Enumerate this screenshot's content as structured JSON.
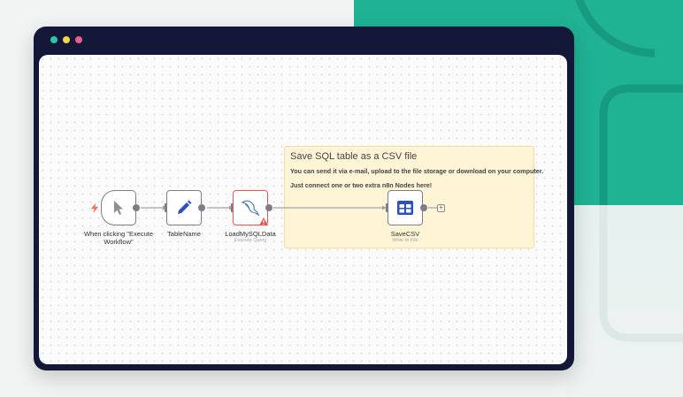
{
  "colors": {
    "accent_teal": "#1fb394",
    "window_frame": "#141838",
    "node_border": "#7d7d87",
    "error": "#f0544f",
    "sticky_bg": "#fff5d6",
    "icon_blue": "#2b4fc9"
  },
  "sticky": {
    "title": "Save SQL table as a CSV file",
    "line1": "You can send it via e-mail, upload to the file storage or download on your computer.",
    "line2": "Just connect one or two extra n8n Nodes here!"
  },
  "nodes": [
    {
      "id": "trigger",
      "label_line1": "When clicking \"Execute",
      "label_line2": "Workflow\"",
      "icon": "cursor-icon"
    },
    {
      "id": "tablename",
      "label": "TableName",
      "icon": "pencil-icon"
    },
    {
      "id": "loadmysql",
      "label": "LoadMySQLData",
      "subtitle": "Execute Query",
      "icon": "mysql-dolphin-icon",
      "status": "warning"
    },
    {
      "id": "savecsv",
      "label": "SaveCSV",
      "subtitle": "Write to File",
      "icon": "table-icon"
    }
  ]
}
